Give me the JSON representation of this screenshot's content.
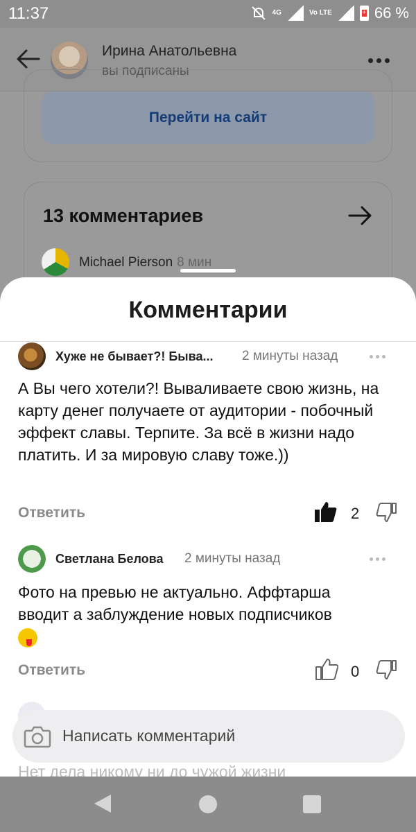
{
  "status_bar": {
    "time": "11:37",
    "net_1": "4G",
    "net_2": "Vo LTE",
    "battery": "66 %",
    "icons": [
      "mute-bell-icon",
      "signal-icon",
      "signal-icon",
      "battery-icon"
    ]
  },
  "header": {
    "author_name": "Ирина Анатольевна",
    "subscription": "вы подписаны"
  },
  "background": {
    "site_button": "Перейти на сайт",
    "comments_title": "13 комментариев",
    "preview_author": "Michael Pierson",
    "preview_time": "8 мин"
  },
  "sheet": {
    "title": "Комментарии",
    "comments": [
      {
        "author": "Хуже не бывает?! Быва...",
        "time": "2 минуты назад",
        "text": "А Вы чего хотели?! Вываливаете свою жизнь, на карту денег получаете от аудитории - побочный эффект славы. Терпите. За всё в жизни надо платить. И за мировую славу тоже.))",
        "reply": "Ответить",
        "likes": "2",
        "liked": true
      },
      {
        "author": "Светлана Белова",
        "time": "2 минуты назад",
        "text": "Фото на превью не актуально. Аффтарша вводит а заблуждение новых подписчиков",
        "reply": "Ответить",
        "likes": "0",
        "liked": false
      }
    ],
    "faded_text": "Нет дела никому ни до чужой жизни"
  },
  "input": {
    "placeholder": "Написать комментарий"
  },
  "colors": {
    "link_blue": "#143d78",
    "sheet_bg": "#ffffff",
    "overlay": "#8e8e8e"
  }
}
